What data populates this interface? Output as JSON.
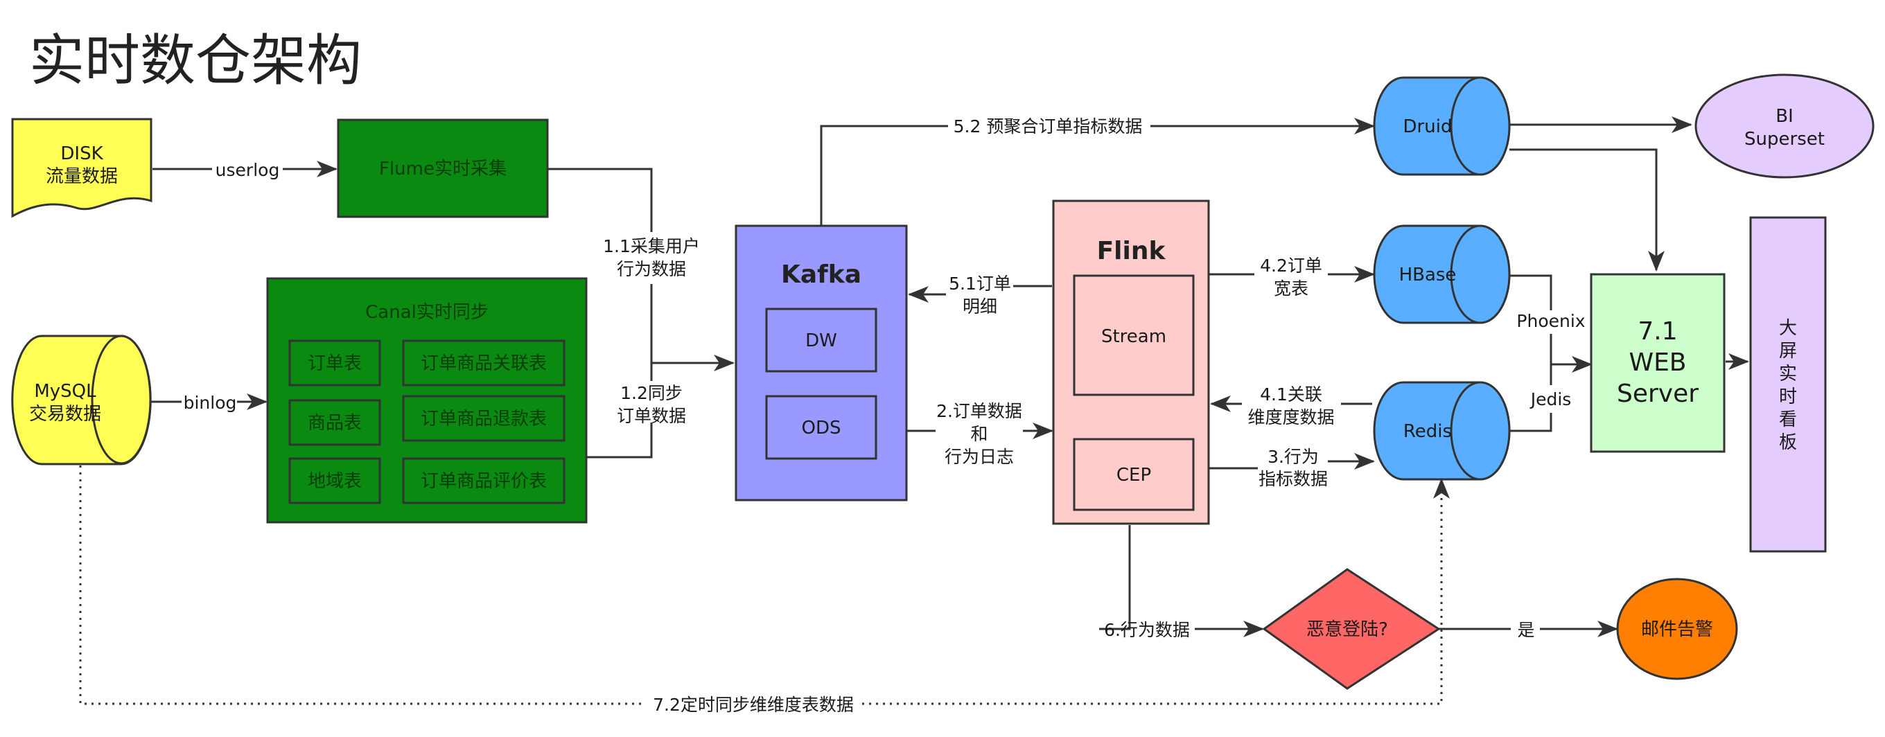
{
  "title": "实时数仓架构",
  "colors": {
    "disk": "#ffff55",
    "green": "#0a8a10",
    "kafka": "#9999ff",
    "flink": "#ffcccc",
    "store": "#5aaeff",
    "bi": "#e5ccff",
    "web": "#ccffcc",
    "screen": "#e5ccff",
    "malicious": "#ff6666",
    "email": "#ff8000"
  },
  "nodes": {
    "disk": [
      "DISK",
      "流量数据"
    ],
    "mysql": [
      "MySQL",
      "交易数据"
    ],
    "flume": "Flume实时采集",
    "canal": {
      "title": "Canal实时同步",
      "tables": [
        "订单表",
        "订单商品关联表",
        "商品表",
        "订单商品退款表",
        "地域表",
        "订单商品评价表"
      ]
    },
    "kafka": {
      "title": "Kafka",
      "dw": "DW",
      "ods": "ODS"
    },
    "flink": {
      "title": "Flink",
      "stream": "Stream",
      "cep": "CEP"
    },
    "druid": "Druid",
    "hbase": "HBase",
    "redis": "Redis",
    "bi": [
      "BI",
      "Superset"
    ],
    "web": [
      "7.1",
      "WEB",
      "Server"
    ],
    "screen": [
      "大",
      "屏",
      "实",
      "时",
      "看",
      "板"
    ],
    "malicious": "恶意登陆?",
    "email": "邮件告警"
  },
  "edges": {
    "userlog": "userlog",
    "binlog": "binlog",
    "e11": [
      "1.1采集用户",
      "行为数据"
    ],
    "e12": [
      "1.2同步",
      "订单数据"
    ],
    "e52": "5.2 预聚合订单指标数据",
    "e51": [
      "5.1订单",
      "明细"
    ],
    "e2": [
      "2.订单数据",
      "和",
      "行为日志"
    ],
    "e42": [
      "4.2订单",
      "宽表"
    ],
    "e41": [
      "4.1关联",
      "维度度数据"
    ],
    "e3": [
      "3.行为",
      "指标数据"
    ],
    "phoenix": "Phoenix",
    "jedis": "Jedis",
    "e6": "6.行为数据",
    "yes": "是",
    "e72": "7.2定时同步维维度表数据"
  }
}
